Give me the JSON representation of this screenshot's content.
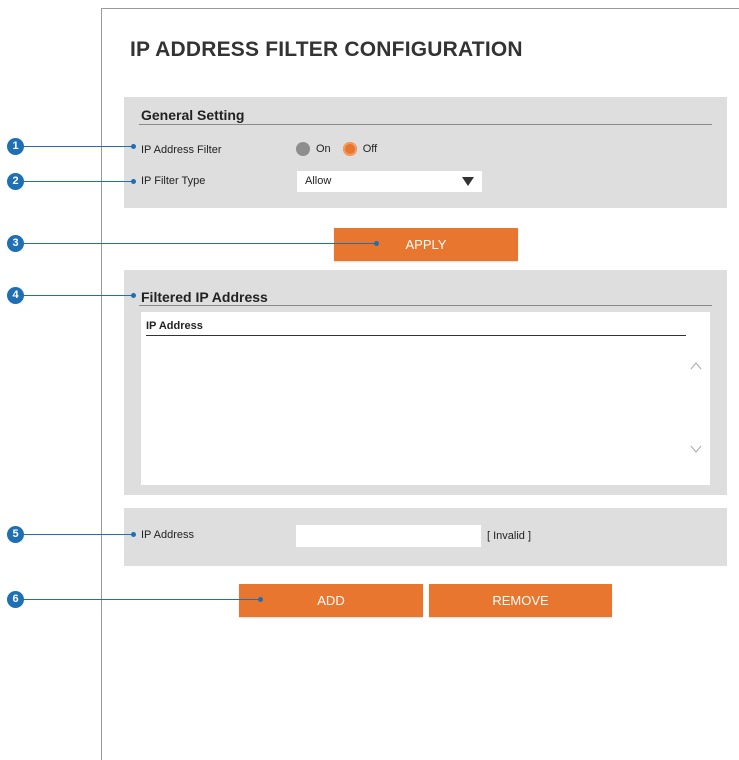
{
  "page": {
    "title": "IP ADDRESS FILTER CONFIGURATION"
  },
  "general": {
    "section_title": "General Setting",
    "filter_label": "IP Address Filter",
    "filter_options": [
      "On",
      "Off"
    ],
    "filter_selected": "Off",
    "type_label": "IP Filter Type",
    "type_value": "Allow"
  },
  "apply_label": "APPLY",
  "filtered": {
    "section_title": "Filtered IP Address",
    "column_header": "IP Address",
    "rows": []
  },
  "ip_entry": {
    "label": "IP Address",
    "value": "",
    "status": "[ Invalid ]"
  },
  "add_label": "ADD",
  "remove_label": "REMOVE",
  "callouts": [
    "1",
    "2",
    "3",
    "4",
    "5",
    "6"
  ],
  "colors": {
    "accent": "#e8762e",
    "panel": "#dedede",
    "callout": "#1e6fb3"
  }
}
